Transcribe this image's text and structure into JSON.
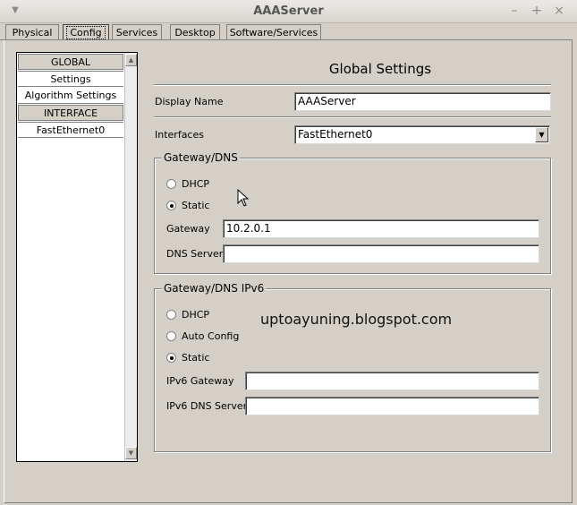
{
  "window": {
    "title": "AAAServer"
  },
  "tabs": [
    "Physical",
    "Config",
    "Services",
    "Desktop",
    "Software/Services"
  ],
  "active_tab": "Config",
  "sidebar": {
    "items": [
      {
        "label": "GLOBAL",
        "kind": "header"
      },
      {
        "label": "Settings",
        "kind": "item"
      },
      {
        "label": "Algorithm Settings",
        "kind": "item"
      },
      {
        "label": "INTERFACE",
        "kind": "header"
      },
      {
        "label": "FastEthernet0",
        "kind": "item"
      }
    ]
  },
  "main": {
    "title": "Global Settings",
    "display_name": {
      "label": "Display Name",
      "value": "AAAServer"
    },
    "interfaces": {
      "label": "Interfaces",
      "value": "FastEthernet0"
    },
    "gateway_dns": {
      "legend": "Gateway/DNS",
      "dhcp_label": "DHCP",
      "static_label": "Static",
      "selected": "Static",
      "gateway_label": "Gateway",
      "gateway_value": "10.2.0.1",
      "dns_label": "DNS Server",
      "dns_value": ""
    },
    "gateway_dns_v6": {
      "legend": "Gateway/DNS IPv6",
      "dhcp_label": "DHCP",
      "auto_label": "Auto Config",
      "static_label": "Static",
      "selected": "Static",
      "gateway_label": "IPv6 Gateway",
      "gateway_value": "",
      "dns_label": "IPv6 DNS Server",
      "dns_value": ""
    },
    "watermark": "uptoayuning.blogspot.com"
  },
  "colors": {
    "background": "#d4d0c8",
    "field": "#ffffff"
  }
}
